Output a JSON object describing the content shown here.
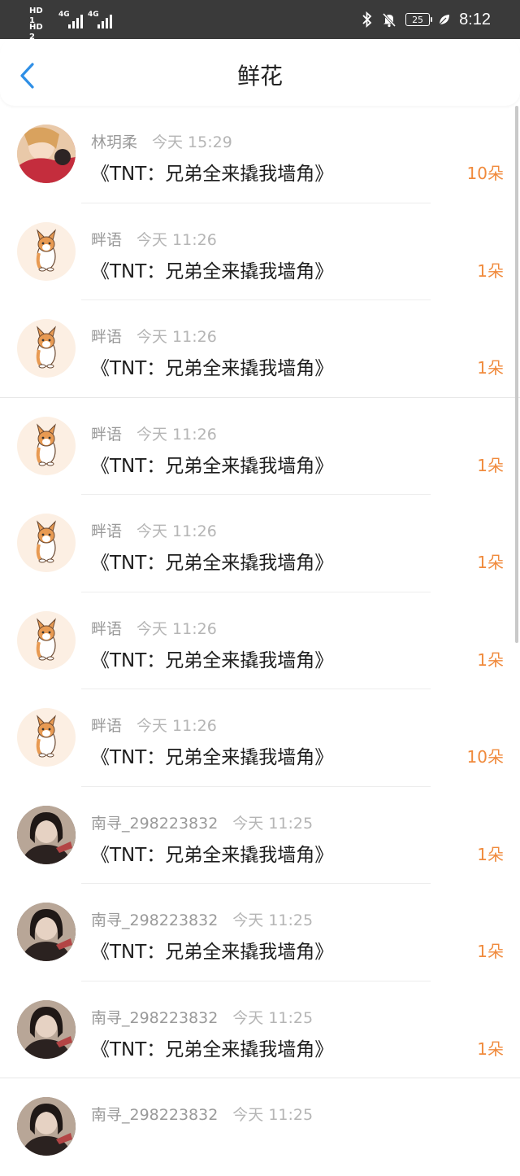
{
  "status_bar": {
    "hd1": "HD 1",
    "hd2": "HD 2",
    "net1": "4G",
    "net2": "4G",
    "battery": "25",
    "time": "8:12"
  },
  "header": {
    "title": "鲜花",
    "back_icon": "chevron-left-icon",
    "accent": "#2f8fe6"
  },
  "count_color": "#f08a3c",
  "items": [
    {
      "user": "林玥柔",
      "time": "今天 15:29",
      "song": "《TNT：兄弟全来撬我墙角》",
      "count": "10朵",
      "avatar": "girl"
    },
    {
      "user": "畔语",
      "time": "今天 11:26",
      "song": "《TNT：兄弟全来撬我墙角》",
      "count": "1朵",
      "avatar": "corgi"
    },
    {
      "user": "畔语",
      "time": "今天 11:26",
      "song": "《TNT：兄弟全来撬我墙角》",
      "count": "1朵",
      "avatar": "corgi"
    },
    {
      "user": "畔语",
      "time": "今天 11:26",
      "song": "《TNT：兄弟全来撬我墙角》",
      "count": "1朵",
      "avatar": "corgi"
    },
    {
      "user": "畔语",
      "time": "今天 11:26",
      "song": "《TNT：兄弟全来撬我墙角》",
      "count": "1朵",
      "avatar": "corgi"
    },
    {
      "user": "畔语",
      "time": "今天 11:26",
      "song": "《TNT：兄弟全来撬我墙角》",
      "count": "1朵",
      "avatar": "corgi"
    },
    {
      "user": "畔语",
      "time": "今天 11:26",
      "song": "《TNT：兄弟全来撬我墙角》",
      "count": "10朵",
      "avatar": "corgi"
    },
    {
      "user": "南寻_298223832",
      "time": "今天 11:25",
      "song": "《TNT：兄弟全来撬我墙角》",
      "count": "1朵",
      "avatar": "dark"
    },
    {
      "user": "南寻_298223832",
      "time": "今天 11:25",
      "song": "《TNT：兄弟全来撬我墙角》",
      "count": "1朵",
      "avatar": "dark"
    },
    {
      "user": "南寻_298223832",
      "time": "今天 11:25",
      "song": "《TNT：兄弟全来撬我墙角》",
      "count": "1朵",
      "avatar": "dark"
    },
    {
      "user": "南寻_298223832",
      "time": "今天 11:25",
      "song": "",
      "count": "",
      "avatar": "dark"
    }
  ]
}
